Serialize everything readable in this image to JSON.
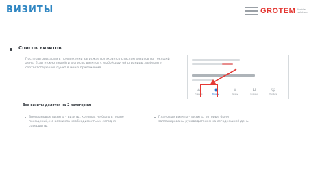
{
  "slide": {
    "title": "ВИЗИТЫ",
    "logo": {
      "brand": "GROTEM",
      "subtitle": "Mobile solutions"
    }
  },
  "section": {
    "title": "Список визитов",
    "intro": "После авторизации в приложении загружается экран со списком визитов на текущий день. Если нужно перейти в список визитов с любой другой страницы, выберите соответствующий пункт в меню приложения."
  },
  "categories": {
    "lead": "Все визиты делятся на 2 категории:",
    "items": [
      {
        "text": "Внеплановые визиты – визиты, которых не было в плане посещений, но возникла необходимость их сегодня совершить."
      },
      {
        "text": "Плановые визиты – визиты, которые были запланированы руководителем на сегодняшний день."
      }
    ]
  },
  "screenshot": {
    "tabs": [
      {
        "icon": "home-icon",
        "label": "Главная"
      },
      {
        "icon": "visits-icon",
        "label": "Визиты"
      },
      {
        "icon": "orders-icon",
        "label": "Заказы"
      },
      {
        "icon": "cart-icon",
        "label": "Корзина"
      },
      {
        "icon": "profile-icon",
        "label": "Профиль"
      }
    ],
    "active_tab": 1,
    "colors": {
      "accent": "#1f6fd0",
      "highlight": "#e53935"
    }
  },
  "theme": {
    "title_color": "#2f86c2",
    "logo_color": "#e3342f"
  }
}
